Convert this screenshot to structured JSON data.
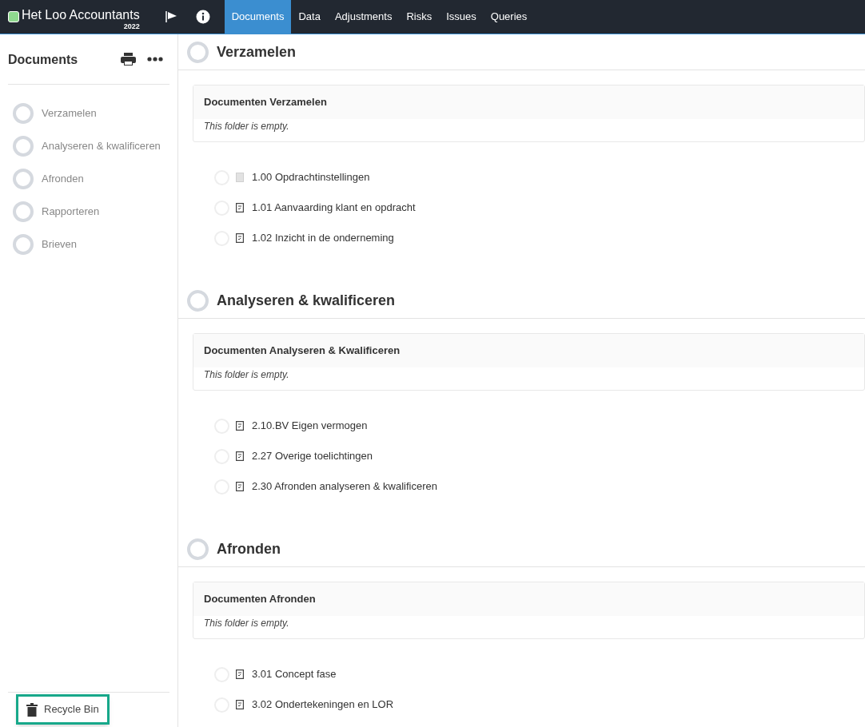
{
  "header": {
    "company": "Het Loo Accountants",
    "year": "2022",
    "tabs": [
      {
        "label": "Documents",
        "selected": true
      },
      {
        "label": "Data",
        "selected": false
      },
      {
        "label": "Adjustments",
        "selected": false
      },
      {
        "label": "Risks",
        "selected": false
      },
      {
        "label": "Issues",
        "selected": false
      },
      {
        "label": "Queries",
        "selected": false
      }
    ]
  },
  "sidebar": {
    "title": "Documents",
    "items": [
      "Verzamelen",
      "Analyseren & kwalificeren",
      "Afronden",
      "Rapporteren",
      "Brieven"
    ],
    "recycle_bin": {
      "label": "Recycle Bin",
      "highlighted": true
    }
  },
  "sections": [
    {
      "title": "Verzamelen",
      "folder": {
        "title": "Documenten Verzamelen",
        "empty_text": "This folder is empty."
      },
      "documents": [
        {
          "name": "1.00 Opdrachtinstellingen",
          "kind": "blank"
        },
        {
          "name": "1.01 Aanvaarding klant en opdracht",
          "kind": "checklist"
        },
        {
          "name": "1.02 Inzicht in de onderneming",
          "kind": "checklist"
        }
      ]
    },
    {
      "title": "Analyseren & kwalificeren",
      "folder": {
        "title": "Documenten Analyseren & Kwalificeren",
        "empty_text": "This folder is empty."
      },
      "documents": [
        {
          "name": "2.10.BV Eigen vermogen",
          "kind": "checklist"
        },
        {
          "name": "2.27 Overige toelichtingen",
          "kind": "checklist"
        },
        {
          "name": "2.30 Afronden analyseren & kwalificeren",
          "kind": "checklist"
        }
      ]
    },
    {
      "title": "Afronden",
      "folder": {
        "title": "Documenten Afronden",
        "empty_text": "This folder is empty."
      },
      "documents": [
        {
          "name": "3.01 Concept fase",
          "kind": "checklist"
        },
        {
          "name": "3.02 Ondertekeningen en LOR",
          "kind": "checklist"
        }
      ]
    }
  ]
}
